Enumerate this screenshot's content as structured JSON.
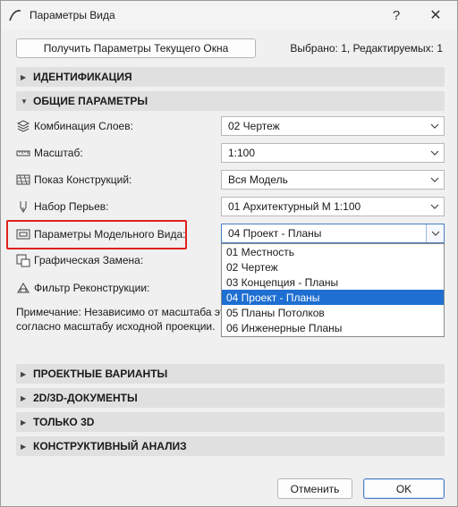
{
  "window": {
    "title": "Параметры Вида",
    "help": "?",
    "close": "✕"
  },
  "top": {
    "get_button": "Получить Параметры Текущего Окна",
    "selection_info": "Выбрано: 1, Редактируемых: 1"
  },
  "sections": {
    "identification": "ИДЕНТИФИКАЦИЯ",
    "general": "ОБЩИЕ ПАРАМЕТРЫ",
    "design_options": "ПРОЕКТНЫЕ ВАРИАНТЫ",
    "docs": "2D/3D-ДОКУМЕНТЫ",
    "only3d": "ТОЛЬКО 3D",
    "structural": "КОНСТРУКТИВНЫЙ АНАЛИЗ"
  },
  "fields": {
    "layer_combo": {
      "label": "Комбинация Слоев:",
      "value": "02 Чертеж"
    },
    "scale": {
      "label": "Масштаб:",
      "value": "1:100"
    },
    "structure": {
      "label": "Показ Конструкций:",
      "value": "Вся Модель"
    },
    "pen_set": {
      "label": "Набор Перьев:",
      "value": "01 Архитектурный М 1:100"
    },
    "model_view": {
      "label": "Параметры Модельного Вида:",
      "value": "04 Проект - Планы"
    },
    "graphic_override": {
      "label": "Графическая Замена:"
    },
    "renovation_filter": {
      "label": "Фильтр Реконструкции:"
    }
  },
  "dropdown": {
    "options": [
      "01 Местность",
      "02 Чертеж",
      "03 Концепция - Планы",
      "04 Проект - Планы",
      "05 Планы Потолков",
      "06 Инженерные Планы"
    ],
    "selected_index": 3
  },
  "note": {
    "line1": "Примечание: Независимо от масштаба это",
    "line2": "согласно масштабу исходной проекции."
  },
  "buttons": {
    "cancel": "Отменить",
    "ok": "OK"
  },
  "colors": {
    "selection": "#1e6fd1",
    "highlight": "#e0201b"
  }
}
